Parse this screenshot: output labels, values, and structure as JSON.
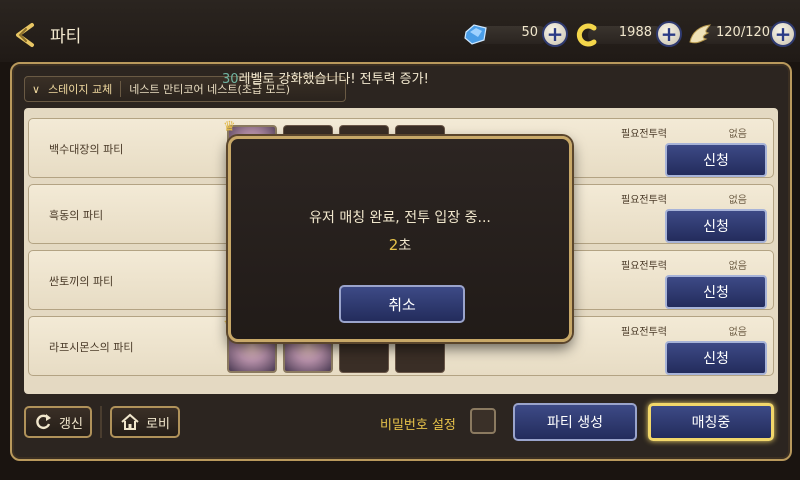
{
  "header": {
    "title": "파티",
    "resources": [
      {
        "name": "gem",
        "value": "50",
        "icon": "gem-icon"
      },
      {
        "name": "coin",
        "value": "1988",
        "icon": "coin-icon"
      },
      {
        "name": "stamina",
        "value": "120/120",
        "icon": "wing-icon"
      }
    ]
  },
  "notice": {
    "level": "30",
    "text": "레벨로 강화했습니다! 전투력 증가!"
  },
  "stage_select": {
    "label": "스테이지 교체",
    "name": "네스트 만티코어 네스트(초급 모드)"
  },
  "parties": [
    {
      "name": "백수대장의 파티",
      "required_label": "필요전투력",
      "required_value": "없음",
      "button": "신청"
    },
    {
      "name": "흑동의 파티",
      "required_label": "필요전투력",
      "required_value": "없음",
      "button": "신청"
    },
    {
      "name": "싼토끼의 파티",
      "required_label": "필요전투력",
      "required_value": "없음",
      "button": "신청"
    },
    {
      "name": "라프시몬스의 파티",
      "required_label": "필요전투력",
      "required_value": "없음",
      "button": "신청"
    }
  ],
  "bottom": {
    "refresh": "갱신",
    "lobby": "로비",
    "password_label": "비밀번호 설정",
    "create_party": "파티 생성",
    "matching": "매칭중"
  },
  "modal": {
    "message": "유저 매칭 완료, 전투 입장 중...",
    "countdown": "2",
    "unit": "초",
    "cancel": "취소"
  },
  "colors": {
    "accent_gold": "#e6c24a",
    "button_blue": "#2f3c78",
    "frame_gold": "#b9995c"
  }
}
